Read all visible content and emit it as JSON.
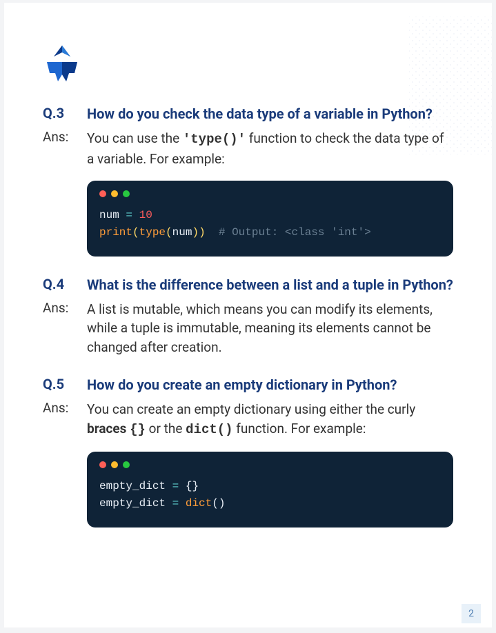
{
  "page_number": "2",
  "questions": [
    {
      "num": "Q.3",
      "text": "How do you check the data type of a variable in Python?",
      "ans_label": "Ans:",
      "ans_html": "You can use the <span class='inline-code'>'type()'</span> function to check the data type of a variable. For example:",
      "code": [
        {
          "tokens": [
            {
              "t": "num ",
              "c": "id"
            },
            {
              "t": "=",
              "c": "eq"
            },
            {
              "t": " ",
              "c": "id"
            },
            {
              "t": "10",
              "c": "num"
            }
          ]
        },
        {
          "tokens": [
            {
              "t": "print",
              "c": "kw"
            },
            {
              "t": "(",
              "c": "par"
            },
            {
              "t": "type",
              "c": "fn"
            },
            {
              "t": "(",
              "c": "par"
            },
            {
              "t": "num",
              "c": "id"
            },
            {
              "t": ")",
              "c": "par"
            },
            {
              "t": ")",
              "c": "par"
            },
            {
              "t": "  # Output: <class 'int'>",
              "c": "cm"
            }
          ]
        }
      ]
    },
    {
      "num": "Q.4",
      "text": "What is the difference between a list and a tuple in Python?",
      "ans_label": "Ans:",
      "ans_html": "A list is mutable, which means you can modify its elements, while a tuple is immutable, meaning its elements cannot be changed after creation.",
      "code": null
    },
    {
      "num": "Q.5",
      "text": "How do you create an empty dictionary in Python?",
      "ans_label": "Ans:",
      "ans_html": "You can create an empty dictionary using either the curly <b>braces</b> <span class='inline-code'>{}</span> or the <span class='inline-code'>dict()</span> function. For example:",
      "code": [
        {
          "tokens": [
            {
              "t": "empty_dict ",
              "c": "id"
            },
            {
              "t": "=",
              "c": "eq"
            },
            {
              "t": " {}",
              "c": "id"
            }
          ]
        },
        {
          "tokens": [
            {
              "t": "empty_dict ",
              "c": "id"
            },
            {
              "t": "=",
              "c": "eq"
            },
            {
              "t": " ",
              "c": "id"
            },
            {
              "t": "dict",
              "c": "fn"
            },
            {
              "t": "()",
              "c": "id"
            }
          ]
        }
      ]
    }
  ]
}
